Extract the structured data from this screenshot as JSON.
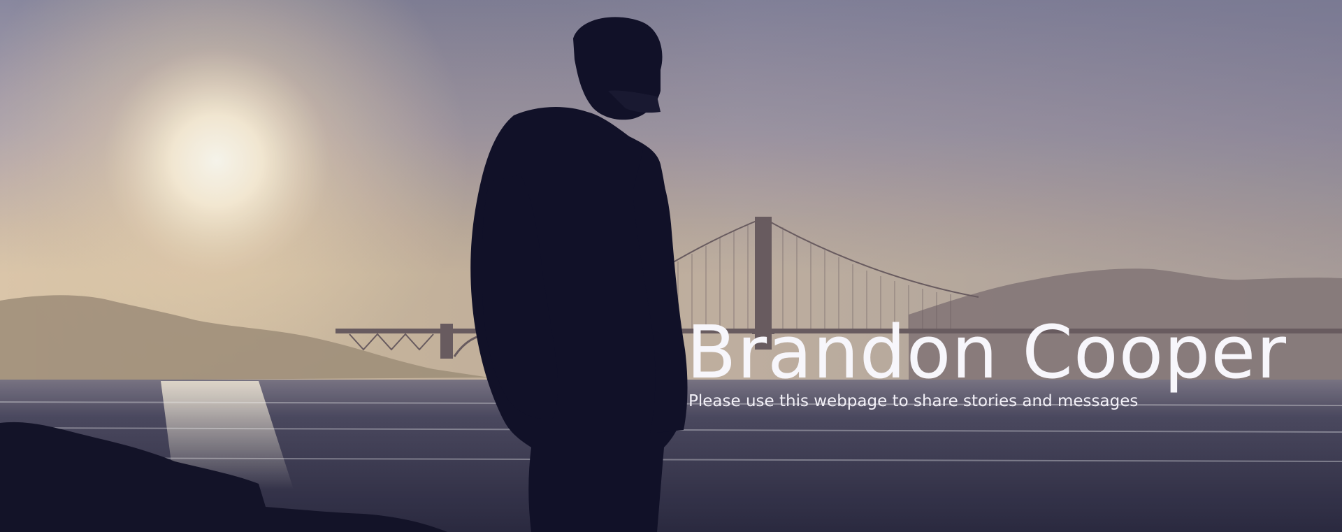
{
  "hero": {
    "title": "Brandon Cooper",
    "subtitle": "Please use this webpage to share stories and messages"
  },
  "colors": {
    "sky_top": "#8b8aa3",
    "sky_mid": "#c9b9ad",
    "sky_horizon": "#e8d2ae",
    "sun": "#fff8e6",
    "water": "#3a3a52",
    "silhouette": "#14142a",
    "bridge": "#6f6066",
    "hills": "#8a7a78",
    "text": "#ffffff"
  },
  "scene": {
    "background_image": "sunset-golden-gate-bridge-silhouette",
    "person": "person-silhouette"
  }
}
